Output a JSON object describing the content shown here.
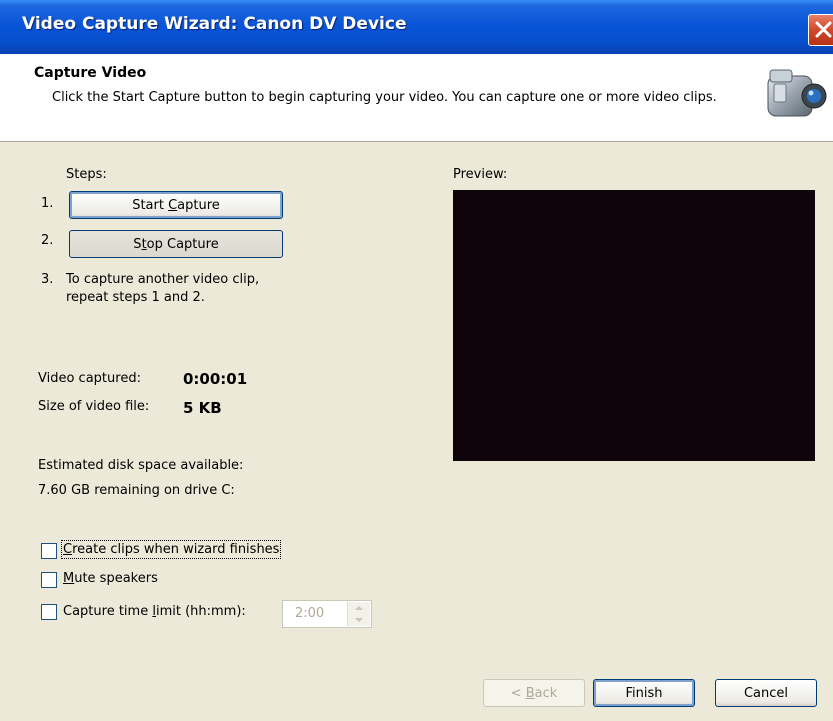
{
  "window": {
    "title": "Video Capture Wizard: Canon DV Device"
  },
  "header": {
    "title": "Capture Video",
    "description": "Click the Start Capture button to begin capturing your video. You can capture one or more video clips."
  },
  "steps": {
    "label": "Steps:",
    "step1_num": "1.",
    "step2_num": "2.",
    "step3_num": "3.",
    "start_capture": {
      "pre": "Start ",
      "accel": "C",
      "post": "apture"
    },
    "stop_capture": {
      "pre": "S",
      "accel": "t",
      "post": "op Capture"
    },
    "step3_text_line1": "To capture another video clip,",
    "step3_text_line2": "repeat steps 1 and 2."
  },
  "stats": {
    "video_captured_label": "Video captured:",
    "video_captured_value": "0:00:01",
    "size_label": "Size of video file:",
    "size_value": "5 KB",
    "disk_label": "Estimated disk space available:",
    "disk_value": "7.60 GB remaining on drive C:"
  },
  "options": {
    "create_clips": {
      "pre": "",
      "accel": "C",
      "post": "reate clips when wizard finishes",
      "checked": false
    },
    "mute": {
      "pre": "",
      "accel": "M",
      "post": "ute speakers",
      "checked": false
    },
    "time_limit": {
      "pre": "Capture time ",
      "accel": "l",
      "post": "imit (hh:mm):",
      "checked": false
    },
    "time_limit_value": "2:00"
  },
  "preview": {
    "label": "Preview:"
  },
  "footer": {
    "back": {
      "pre": "< ",
      "accel": "B",
      "post": "ack"
    },
    "finish": "Finish",
    "cancel": "Cancel"
  },
  "colors": {
    "titlebar": "#0a54d8",
    "face": "#ECE9D8",
    "preview_bg": "#0f040a"
  },
  "icons": [
    "close-icon",
    "video-camera-icon",
    "spin-up-icon",
    "spin-down-icon"
  ]
}
